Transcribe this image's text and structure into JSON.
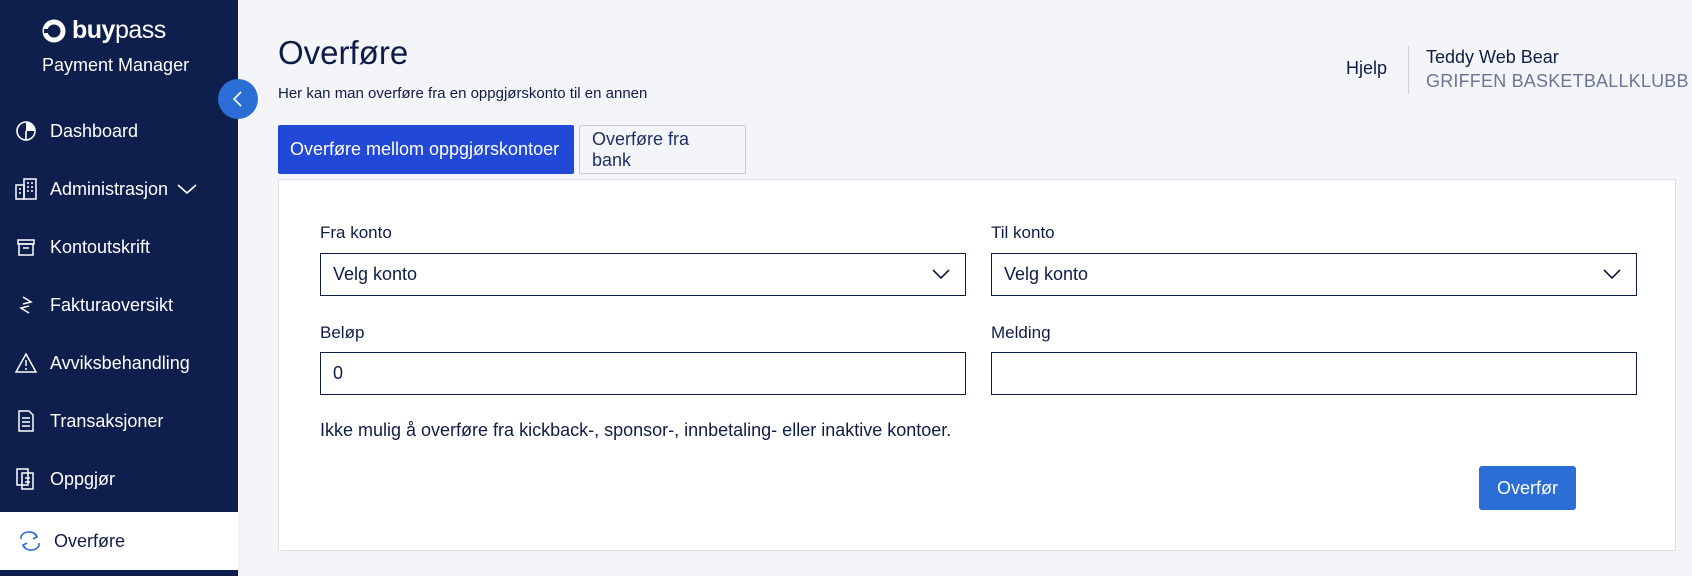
{
  "brand": {
    "logo_text_bold": "buy",
    "logo_text_light": "pass",
    "product": "Payment Manager"
  },
  "nav": {
    "items": [
      {
        "label": "Dashboard",
        "icon": "pie-chart-icon"
      },
      {
        "label": "Administrasjon",
        "icon": "building-icon"
      },
      {
        "label": "Kontoutskrift",
        "icon": "archive-icon"
      },
      {
        "label": "Fakturaoversikt",
        "icon": "transfer-arrows-icon"
      },
      {
        "label": "Avviksbehandling",
        "icon": "warning-icon"
      },
      {
        "label": "Transaksjoner",
        "icon": "document-icon"
      },
      {
        "label": "Oppgjør",
        "icon": "documents-icon"
      },
      {
        "label": "Overføre",
        "icon": "refresh-icon"
      }
    ],
    "active_index": 7
  },
  "header": {
    "title": "Overføre",
    "subtitle": "Her kan man overføre fra en oppgjørskonto til en annen",
    "help": "Hjelp",
    "user_name": "Teddy Web Bear",
    "user_org": "GRIFFEN BASKETBALLKLUBB"
  },
  "tabs": [
    {
      "label": "Overføre mellom oppgjørskontoer",
      "active": true
    },
    {
      "label": "Overføre fra bank",
      "active": false
    }
  ],
  "form": {
    "from_label": "Fra konto",
    "from_value": "Velg konto",
    "to_label": "Til konto",
    "to_value": "Velg konto",
    "amount_label": "Beløp",
    "amount_value": "0",
    "message_label": "Melding",
    "message_value": "",
    "note": "Ikke mulig å overføre fra kickback-, sponsor-, innbetaling- eller inaktive kontoer.",
    "submit_label": "Overfør"
  },
  "colors": {
    "sidebar": "#0e1e4d",
    "accent": "#2148d6",
    "button": "#2b6fd6"
  }
}
